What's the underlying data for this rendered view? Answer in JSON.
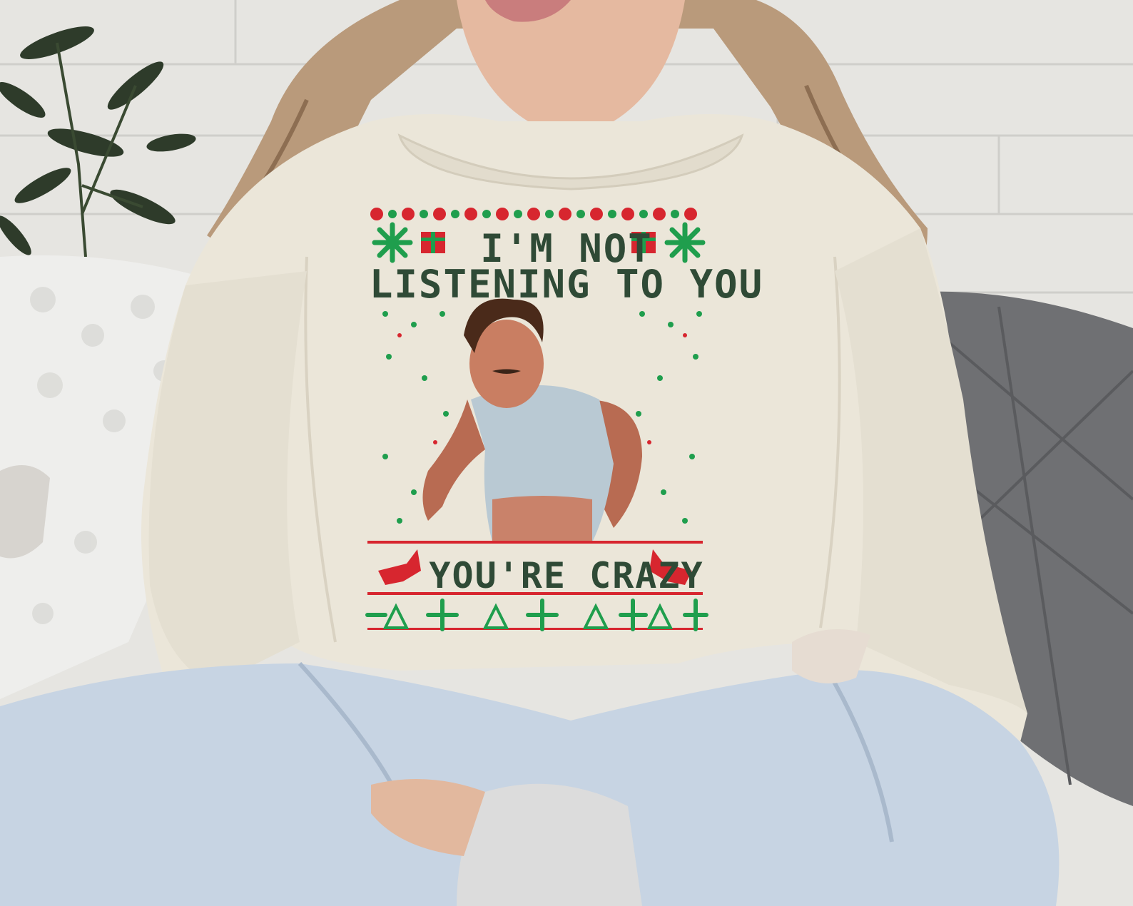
{
  "print": {
    "line1": "I'M NOT",
    "line2": "LISTENING TO YOU",
    "line3": "YOU'RE CRAZY"
  },
  "colors": {
    "wall": "#e6e5e1",
    "sweatshirt": "#ebe6d9",
    "print_green": "#1f9e4d",
    "print_red": "#d7262f",
    "text_dark": "#2f4a36",
    "jeans": "#c7d4e3",
    "hair": "#b99a7b",
    "pillow_dark": "#6f7073"
  }
}
